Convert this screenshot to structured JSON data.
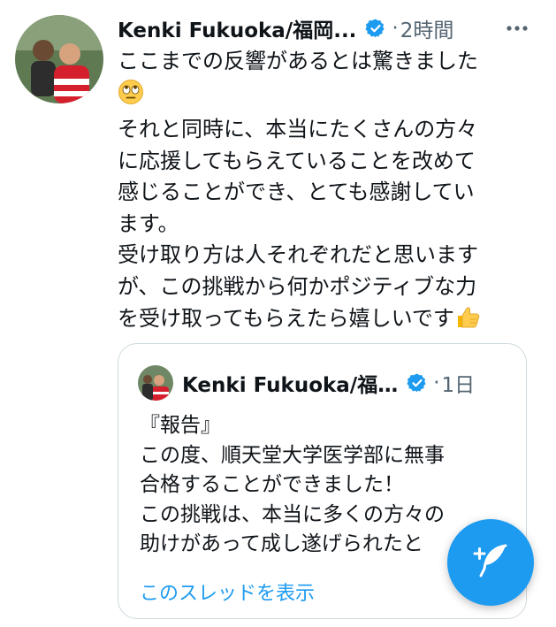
{
  "tweet": {
    "author_name": "Kenki Fukuoka/福岡...",
    "separator": "·",
    "timestamp": "2時間",
    "lines": [
      "ここまでの反響があるとは驚きました",
      "それと同時に、本当にたくさんの方々",
      "に応援してもらえていることを改めて",
      "感じることができ、とても感謝してい",
      "ます。",
      "受け取り方は人それぞれだと思います",
      "が、この挑戦から何かポジティブな力",
      "を受け取ってもらえたら嬉しいです"
    ],
    "emoji_1": "rolling-eyes-emoji",
    "emoji_2": "thumbs-up-emoji"
  },
  "quote": {
    "author_name": "Kenki Fukuoka/福…",
    "separator": "·",
    "timestamp": "1日",
    "lines": [
      "『報告』",
      "この度、順天堂大学医学部に無事",
      "合格することができました！",
      "この挑戦は、本当に多くの方々の",
      "助けがあって成し遂げられたと"
    ],
    "show_thread": "このスレッドを表示"
  },
  "colors": {
    "accent": "#1d9bf0",
    "text": "#0f1419",
    "muted": "#536471",
    "border": "#cfd9de"
  },
  "icons": {
    "verified": "verified-badge-icon",
    "more": "more-dots-icon",
    "compose": "compose-feather-icon"
  }
}
